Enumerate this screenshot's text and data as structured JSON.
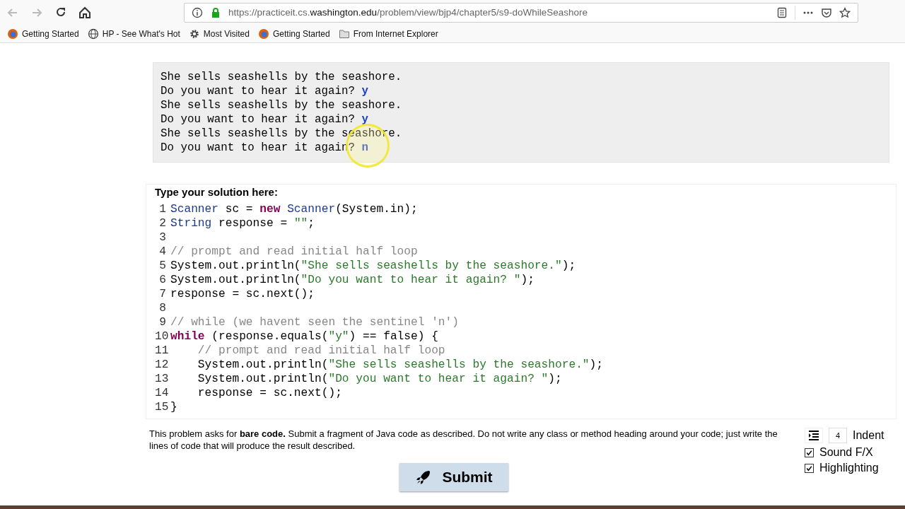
{
  "browser": {
    "url_prefix": "https://practiceit.cs.",
    "url_host": "washington.edu",
    "url_path": "/problem/view/bjp4/chapter5/s9-doWhileSeashore"
  },
  "bookmarks": [
    {
      "kind": "firefox",
      "label": "Getting Started"
    },
    {
      "kind": "globe",
      "label": "HP - See What's Hot"
    },
    {
      "kind": "gear",
      "label": "Most Visited"
    },
    {
      "kind": "firefox",
      "label": "Getting Started"
    },
    {
      "kind": "folder",
      "label": "From Internet Explorer"
    }
  ],
  "expected_output": [
    {
      "text": "She sells seashells by the seashore."
    },
    {
      "text": "Do you want to hear it again? ",
      "input": "y"
    },
    {
      "text": "She sells seashells by the seashore."
    },
    {
      "text": "Do you want to hear it again? ",
      "input": "y"
    },
    {
      "text": "She sells seashells by the seashore."
    },
    {
      "text": "Do you want to hear it again? ",
      "input": "n"
    }
  ],
  "solution": {
    "heading": "Type your solution here:",
    "lines": [
      {
        "number": "1",
        "tokens": [
          {
            "kind": "type",
            "text": "Scanner"
          },
          {
            "kind": "plain",
            "text": " sc = "
          },
          {
            "kind": "keyword",
            "text": "new "
          },
          {
            "kind": "type",
            "text": "Scanner"
          },
          {
            "kind": "plain",
            "text": "(System.in);"
          }
        ]
      },
      {
        "number": "2",
        "tokens": [
          {
            "kind": "type",
            "text": "String"
          },
          {
            "kind": "plain",
            "text": " response = "
          },
          {
            "kind": "string",
            "text": "\"\""
          },
          {
            "kind": "plain",
            "text": ";"
          }
        ]
      },
      {
        "number": "3"
      },
      {
        "number": "4",
        "tokens": [
          {
            "kind": "comment",
            "text": "// prompt and read initial half loop"
          }
        ]
      },
      {
        "number": "5",
        "tokens": [
          {
            "kind": "plain",
            "text": "System.out.println("
          },
          {
            "kind": "string",
            "text": "\"She sells seashells by the seashore.\""
          },
          {
            "kind": "plain",
            "text": ");"
          }
        ]
      },
      {
        "number": "6",
        "tokens": [
          {
            "kind": "plain",
            "text": "System.out.println("
          },
          {
            "kind": "string",
            "text": "\"Do you want to hear it again? \""
          },
          {
            "kind": "plain",
            "text": ");"
          }
        ]
      },
      {
        "number": "7",
        "tokens": [
          {
            "kind": "plain",
            "text": "response = sc.next();"
          }
        ]
      },
      {
        "number": "8"
      },
      {
        "number": "9",
        "tokens": [
          {
            "kind": "comment",
            "text": "// while (we havent seen the sentinel 'n')"
          }
        ]
      },
      {
        "number": "10",
        "tokens": [
          {
            "kind": "keyword",
            "text": "while"
          },
          {
            "kind": "plain",
            "text": " (response.equals("
          },
          {
            "kind": "string",
            "text": "\"y\""
          },
          {
            "kind": "plain",
            "text": ") == false) {"
          }
        ]
      },
      {
        "number": "11",
        "tokens": [
          {
            "kind": "comment",
            "text": "    // prompt and read initial half loop"
          }
        ]
      },
      {
        "number": "12",
        "tokens": [
          {
            "kind": "plain",
            "text": "    System.out.println("
          },
          {
            "kind": "string",
            "text": "\"She sells seashells by the seashore.\""
          },
          {
            "kind": "plain",
            "text": ");"
          }
        ]
      },
      {
        "number": "13",
        "tokens": [
          {
            "kind": "plain",
            "text": "    System.out.println("
          },
          {
            "kind": "string",
            "text": "\"Do you want to hear it again? \""
          },
          {
            "kind": "plain",
            "text": ");"
          }
        ]
      },
      {
        "number": "14",
        "tokens": [
          {
            "kind": "plain",
            "text": "    response = sc.next();"
          }
        ]
      },
      {
        "number": "15",
        "tokens": [
          {
            "kind": "plain",
            "text": "}"
          }
        ]
      }
    ]
  },
  "note": "This problem asks for **bare code.** Submit a fragment of Java code as described. Do not write any class or method heading around your code; just write the lines of code that will produce the result described.",
  "indent": {
    "value": "4",
    "label": "Indent"
  },
  "options": [
    {
      "label": "Sound F/X",
      "checked": true
    },
    {
      "label": "Highlighting",
      "checked": true
    }
  ],
  "submit": "Submit"
}
